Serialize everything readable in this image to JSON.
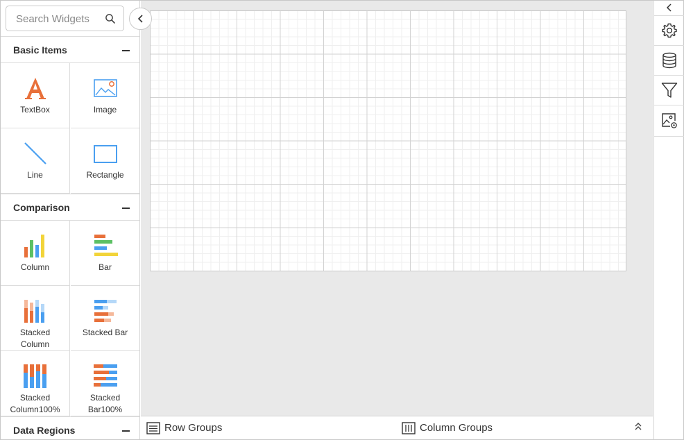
{
  "search": {
    "placeholder": "Search Widgets"
  },
  "sections": [
    {
      "title": "Basic Items",
      "items": [
        {
          "label": "TextBox",
          "icon": "textbox-icon"
        },
        {
          "label": "Image",
          "icon": "image-icon"
        },
        {
          "label": "Line",
          "icon": "line-icon"
        },
        {
          "label": "Rectangle",
          "icon": "rectangle-icon"
        }
      ]
    },
    {
      "title": "Comparison",
      "items": [
        {
          "label": "Column",
          "icon": "column-chart-icon"
        },
        {
          "label": "Bar",
          "icon": "bar-chart-icon"
        },
        {
          "label": "Stacked Column",
          "label_lines": [
            "Stacked",
            "Column"
          ],
          "icon": "stacked-column-icon"
        },
        {
          "label": "Stacked Bar",
          "icon": "stacked-bar-icon"
        },
        {
          "label": "Stacked Column100%",
          "label_lines": [
            "Stacked",
            "Column100%"
          ],
          "icon": "stacked-column-100-icon"
        },
        {
          "label": "Stacked Bar100%",
          "label_lines": [
            "Stacked",
            "Bar100%"
          ],
          "icon": "stacked-bar-100-icon"
        }
      ]
    },
    {
      "title": "Data Regions",
      "items": []
    }
  ],
  "group_bar": {
    "row_groups": "Row Groups",
    "column_groups": "Column Groups"
  },
  "right_panel": {
    "items": [
      "collapse-icon",
      "settings-icon",
      "database-icon",
      "filter-icon",
      "image-settings-icon"
    ]
  },
  "colors": {
    "orange": "#e8703a",
    "blue": "#4a9ff0",
    "green": "#5cc064",
    "yellow": "#f2d43a",
    "light_orange": "#f5b89a",
    "light_blue": "#b5d8f8"
  }
}
